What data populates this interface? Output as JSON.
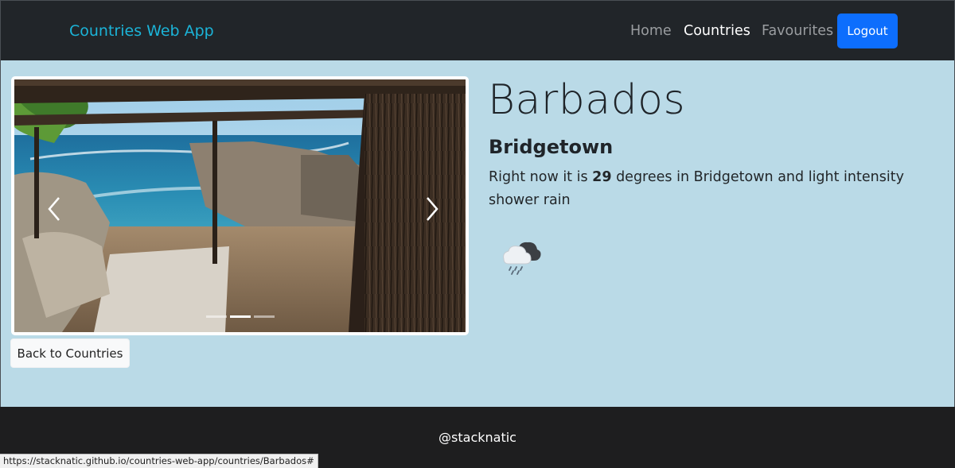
{
  "navbar": {
    "brand": "Countries Web App",
    "links": [
      "Home",
      "Countries",
      "Favourites"
    ],
    "active_link": "Countries",
    "logout_label": "Logout"
  },
  "carousel": {
    "slide_count": 3,
    "active_slide": 2,
    "prev_icon": "chevron-left-icon",
    "next_icon": "chevron-right-icon"
  },
  "actions": {
    "back_label": "Back to Countries"
  },
  "country": {
    "name": "Barbados",
    "capital": "Bridgetown",
    "weather": {
      "prefix": "Right now it is ",
      "temperature": "29",
      "middle": " degrees in ",
      "city": "Bridgetown",
      "connector": " and ",
      "description": "light intensity shower rain",
      "icon": "rain-cloud-icon"
    }
  },
  "footer": {
    "text": "@stacknatic"
  },
  "status_bar": {
    "url": "https://stacknatic.github.io/countries-web-app/countries/Barbados#"
  },
  "colors": {
    "navbar": "#212529",
    "brand": "#1bb4d8",
    "main_bg": "#badae7",
    "logout": "#0d6efd",
    "footer": "#1e1e1f"
  }
}
